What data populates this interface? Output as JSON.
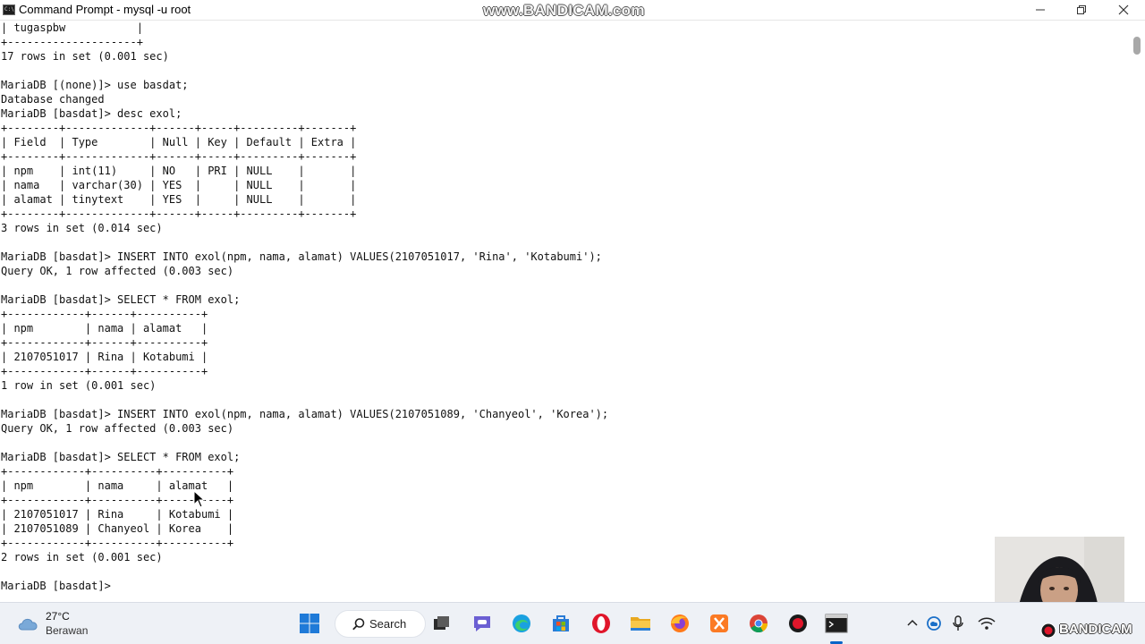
{
  "window": {
    "title": "Command Prompt - mysql  -u root",
    "watermark": "www.BANDICAM.com"
  },
  "console": {
    "lines": [
      "| tugaspbw           |",
      "+--------------------+",
      "17 rows in set (0.001 sec)",
      "",
      "MariaDB [(none)]> use basdat;",
      "Database changed",
      "MariaDB [basdat]> desc exol;",
      "+--------+-------------+------+-----+---------+-------+",
      "| Field  | Type        | Null | Key | Default | Extra |",
      "+--------+-------------+------+-----+---------+-------+",
      "| npm    | int(11)     | NO   | PRI | NULL    |       |",
      "| nama   | varchar(30) | YES  |     | NULL    |       |",
      "| alamat | tinytext    | YES  |     | NULL    |       |",
      "+--------+-------------+------+-----+---------+-------+",
      "3 rows in set (0.014 sec)",
      "",
      "MariaDB [basdat]> INSERT INTO exol(npm, nama, alamat) VALUES(2107051017, 'Rina', 'Kotabumi');",
      "Query OK, 1 row affected (0.003 sec)",
      "",
      "MariaDB [basdat]> SELECT * FROM exol;",
      "+------------+------+----------+",
      "| npm        | nama | alamat   |",
      "+------------+------+----------+",
      "| 2107051017 | Rina | Kotabumi |",
      "+------------+------+----------+",
      "1 row in set (0.001 sec)",
      "",
      "MariaDB [basdat]> INSERT INTO exol(npm, nama, alamat) VALUES(2107051089, 'Chanyeol', 'Korea');",
      "Query OK, 1 row affected (0.003 sec)",
      "",
      "MariaDB [basdat]> SELECT * FROM exol;",
      "+------------+----------+----------+",
      "| npm        | nama     | alamat   |",
      "+------------+----------+----------+",
      "| 2107051017 | Rina     | Kotabumi |",
      "| 2107051089 | Chanyeol | Korea    |",
      "+------------+----------+----------+",
      "2 rows in set (0.001 sec)",
      "",
      "MariaDB [basdat]>"
    ]
  },
  "taskbar": {
    "weather_temp": "27°C",
    "weather_condition": "Berawan",
    "search_label": "Search",
    "accent_color": "#0a64c8",
    "icons": [
      "windows-start-icon",
      "search-icon",
      "task-view-icon",
      "teams-chat-icon",
      "edge-icon",
      "microsoft-store-icon",
      "opera-icon",
      "file-explorer-icon",
      "firefox-icon",
      "xampp-icon",
      "chrome-icon",
      "bandicam-record-icon",
      "command-prompt-icon",
      "chevron-up-icon",
      "onedrive-icon",
      "microphone-icon",
      "wifi-icon"
    ]
  },
  "overlay": {
    "bandicam_logo": "BANDICAM"
  }
}
